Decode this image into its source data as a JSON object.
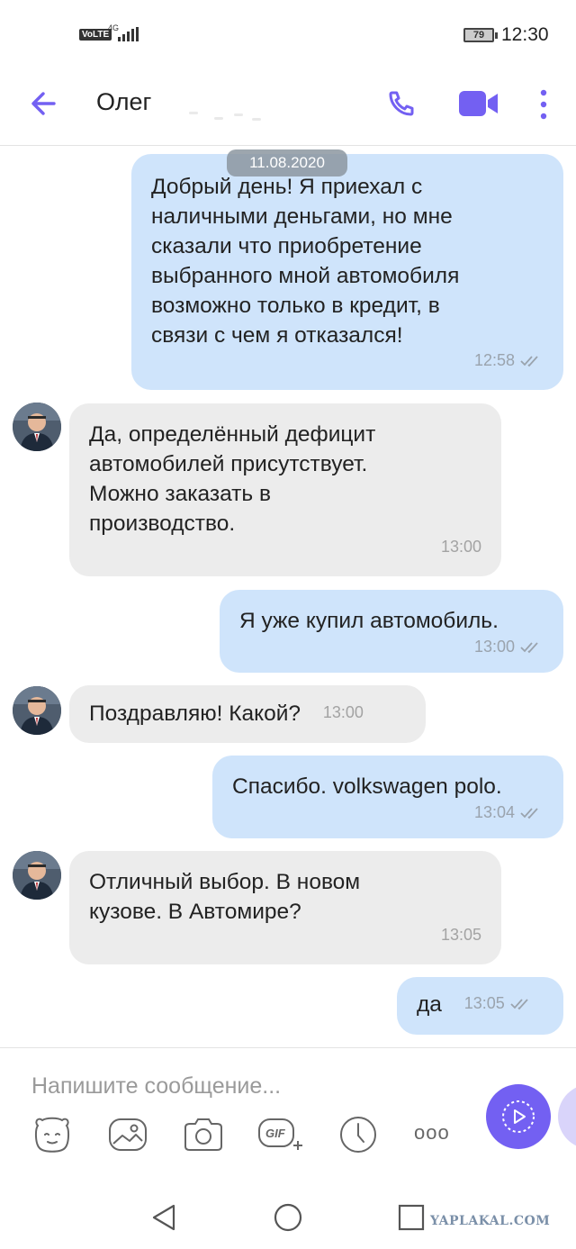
{
  "status_bar": {
    "volte": "VoLTE",
    "network": "4G",
    "battery": "79",
    "time": "12:30"
  },
  "header": {
    "contact_name": "Олег",
    "back_icon": "arrow-left-icon",
    "call_icon": "phone-icon",
    "video_icon": "video-camera-icon",
    "more_icon": "more-vertical-icon",
    "accent_color": "#7360f2"
  },
  "chat": {
    "date_separator": "11.08.2020",
    "messages": [
      {
        "direction": "outgoing",
        "text": "Добрый день! Я приехал с\nналичными деньгами, но мне\nсказали что приобретение\nвыбранного мной автомобиля\nвозможно только в кредит, в\nсвязи с чем я отказался!",
        "time": "12:58",
        "status": "read"
      },
      {
        "direction": "incoming",
        "text": "Да, определённый дефицит\nавтомобилей присутствует.\nМожно заказать в\nпроизводство.",
        "time": "13:00"
      },
      {
        "direction": "outgoing",
        "text": "Я уже купил автомобиль.",
        "time": "13:00",
        "status": "read"
      },
      {
        "direction": "incoming",
        "text": "Поздравляю! Какой?",
        "time": "13:00"
      },
      {
        "direction": "outgoing",
        "text": "Спасибо. volkswagen polo.",
        "time": "13:04",
        "status": "read"
      },
      {
        "direction": "incoming",
        "text": "Отличный выбор. В новом\nкузове. В Автомире?",
        "time": "13:05"
      },
      {
        "direction": "outgoing",
        "text": "да",
        "time": "13:05",
        "status": "read"
      }
    ],
    "outgoing_bubble_color": "#cfe4fb",
    "incoming_bubble_color": "#ececec"
  },
  "composer": {
    "placeholder": "Напишите сообщение...",
    "tools": [
      "sticker-icon",
      "gallery-icon",
      "camera-icon",
      "gif-icon",
      "clock-icon",
      "more-horizontal-icon"
    ],
    "gif_label": "GIF",
    "more_label": "ooo"
  },
  "navbar": {
    "buttons": [
      "back-triangle-icon",
      "home-circle-icon",
      "recents-square-icon"
    ],
    "watermark": "YAPLAKAL.COM"
  }
}
